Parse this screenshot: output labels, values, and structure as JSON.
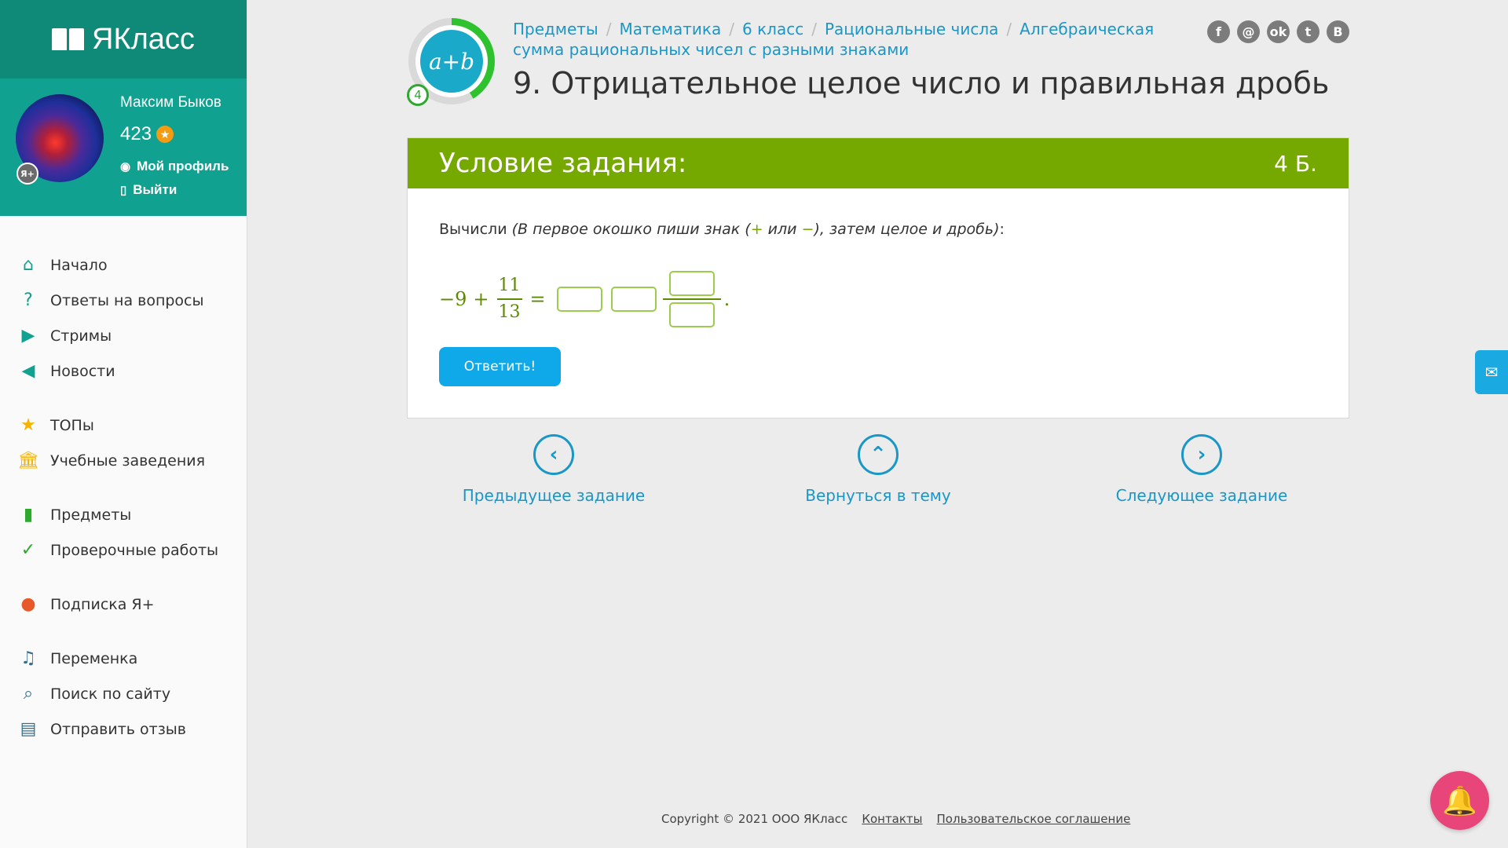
{
  "brand": {
    "logo_text": "ЯКласс"
  },
  "profile": {
    "name": "Максим Быков",
    "points": "423",
    "my_profile_label": "Мой профиль",
    "logout_label": "Выйти"
  },
  "nav": {
    "items": [
      {
        "label": "Начало",
        "icon": "home-icon"
      },
      {
        "label": "Ответы на вопросы",
        "icon": "question-icon"
      },
      {
        "label": "Стримы",
        "icon": "play-icon"
      },
      {
        "label": "Новости",
        "icon": "megaphone-icon"
      },
      {
        "label": "ТОПы",
        "icon": "star-icon"
      },
      {
        "label": "Учебные заведения",
        "icon": "building-icon"
      },
      {
        "label": "Предметы",
        "icon": "book-icon"
      },
      {
        "label": "Проверочные работы",
        "icon": "check-icon"
      },
      {
        "label": "Подписка Я+",
        "icon": "subscription-icon"
      },
      {
        "label": "Переменка",
        "icon": "bell-icon"
      },
      {
        "label": "Поиск по сайту",
        "icon": "search-icon"
      },
      {
        "label": "Отправить отзыв",
        "icon": "feedback-icon"
      }
    ]
  },
  "topic": {
    "badge_text": "a+b",
    "level": "4"
  },
  "breadcrumb": {
    "items": [
      "Предметы",
      "Математика",
      "6 класс",
      "Рациональные числа",
      "Алгебраическая сумма рациональных чисел с разными знаками"
    ]
  },
  "page": {
    "title": "9. Отрицательное целое число и правильная дробь"
  },
  "social": [
    "f",
    "@",
    "ok",
    "tw",
    "В"
  ],
  "task": {
    "header": "Условие задания:",
    "points": "4 Б.",
    "instruction_main": "Вычисли",
    "instruction_hint_a": "(В первое окошко пиши знак (",
    "plus": "+",
    "or": " или ",
    "minus": "−",
    "instruction_hint_b": "), затем целое и дробь)",
    "colon": ":",
    "whole": "−9",
    "op": "+",
    "numerator": "11",
    "denominator": "13",
    "equals": "=",
    "dot": ".",
    "submit_label": "Ответить!"
  },
  "task_nav": {
    "prev": "Предыдущее задание",
    "up": "Вернуться в тему",
    "next": "Следующее задание"
  },
  "footer": {
    "copyright": "Copyright © 2021 ООО ЯКласс",
    "contacts": "Контакты",
    "agreement": "Пользовательское соглашение"
  },
  "colors": {
    "brand_green": "#0f8a78",
    "task_header": "#76a900",
    "link_blue": "#1a97c7",
    "button_blue": "#0fa8e8"
  }
}
